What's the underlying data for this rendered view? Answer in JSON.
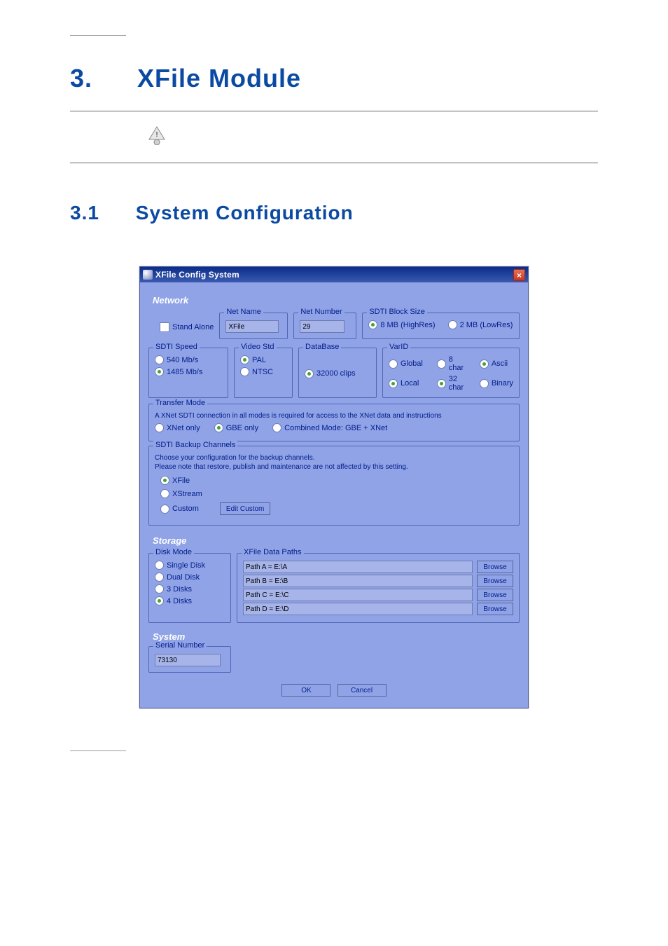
{
  "heading": {
    "num": "3.",
    "title": "XFile  Module"
  },
  "subheading": {
    "num": "3.1",
    "title": "System  Configuration"
  },
  "dialog": {
    "title": "XFile Config System",
    "network": {
      "title": "Network",
      "stand_alone": "Stand Alone",
      "net_name": {
        "label": "Net Name",
        "value": "XFile"
      },
      "net_number": {
        "label": "Net Number",
        "value": "29"
      },
      "sdti_block": {
        "label": "SDTI Block Size",
        "opt1": "8 MB (HighRes)",
        "opt2": "2 MB (LowRes)"
      },
      "sdti_speed": {
        "label": "SDTI Speed",
        "opt1": "540 Mb/s",
        "opt2": "1485 Mb/s"
      },
      "video_std": {
        "label": "Video Std",
        "opt1": "PAL",
        "opt2": "NTSC"
      },
      "database": {
        "label": "DataBase",
        "opt1": "32000 clips"
      },
      "varid": {
        "label": "VarID",
        "opt1": "Global",
        "opt2": "Local",
        "opt3": "8 char",
        "opt4": "32 char",
        "opt5": "Ascii",
        "opt6": "Binary"
      },
      "transfer": {
        "label": "Transfer Mode",
        "desc": "A XNet SDTI connection in all modes is required for access to the XNet data and instructions",
        "opt1": "XNet only",
        "opt2": "GBE only",
        "opt3": "Combined Mode: GBE + XNet"
      },
      "backup": {
        "label": "SDTI Backup Channels",
        "desc1": "Choose your configuration for the backup channels.",
        "desc2": "Please note that restore, publish and maintenance are not affected by this setting.",
        "opt1": "XFile",
        "opt2": "XStream",
        "opt3": "Custom",
        "btn": "Edit Custom"
      }
    },
    "storage": {
      "title": "Storage",
      "disk": {
        "label": "Disk Mode",
        "opt1": "Single Disk",
        "opt2": "Dual Disk",
        "opt3": "3 Disks",
        "opt4": "4 Disks"
      },
      "paths": {
        "label": "XFile Data Paths",
        "a": "Path A = E:\\A",
        "b": "Path B = E:\\B",
        "c": "Path C = E:\\C",
        "d": "Path D = E:\\D",
        "browse": "Browse"
      }
    },
    "system": {
      "title": "System",
      "serial": {
        "label": "Serial Number",
        "value": "73130"
      }
    },
    "buttons": {
      "ok": "OK",
      "cancel": "Cancel"
    }
  }
}
